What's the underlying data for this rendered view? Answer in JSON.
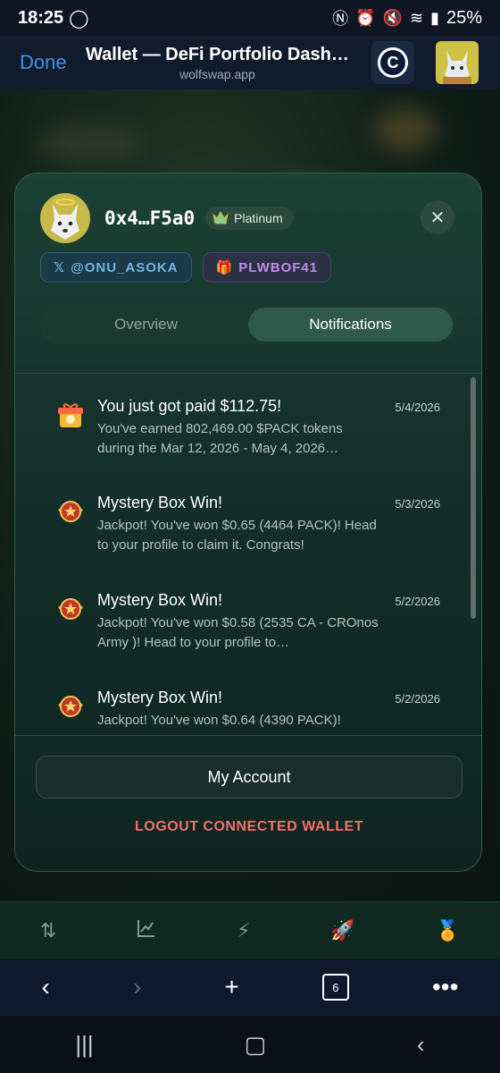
{
  "status_bar": {
    "time": "18:25",
    "battery": "25%"
  },
  "browser": {
    "done_label": "Done",
    "page_title": "Wallet — DeFi Portfolio Dashboard",
    "url": "wolfswap.app",
    "tabs_count": "6"
  },
  "profile": {
    "address": "0x4…F5a0",
    "tier": "Platinum",
    "twitter_handle": "@ONU_ASOKA",
    "referral_code": "PLWBOF41"
  },
  "tabs": [
    {
      "label": "Overview",
      "active": false
    },
    {
      "label": "Notifications",
      "active": true
    }
  ],
  "notifications": [
    {
      "icon": "gift-icon",
      "title": "You just got paid $112.75!",
      "date": "5/4/2026",
      "text": "You've earned 802,469.00 $PACK tokens during the Mar 12, 2026 - May 4, 2026…"
    },
    {
      "icon": "mystery-box-badge-icon",
      "title": "Mystery Box Win!",
      "date": "5/3/2026",
      "text": "Jackpot! You've won $0.65 (4464 PACK)! Head to your profile to claim it. Congrats!"
    },
    {
      "icon": "mystery-box-badge-icon",
      "title": "Mystery Box Win!",
      "date": "5/2/2026",
      "text": "Jackpot! You've won $0.58 (2535 CA - CROnos Army )! Head to your profile to…"
    },
    {
      "icon": "mystery-box-badge-icon",
      "title": "Mystery Box Win!",
      "date": "5/2/2026",
      "text": "Jackpot! You've won $0.64 (4390 PACK)!"
    }
  ],
  "actions": {
    "my_account": "My Account",
    "logout": "LOGOUT CONNECTED WALLET"
  },
  "colors": {
    "accent_blue": "#3d93e8",
    "logout_red": "#f0736c",
    "card_green": "#1c4135"
  }
}
